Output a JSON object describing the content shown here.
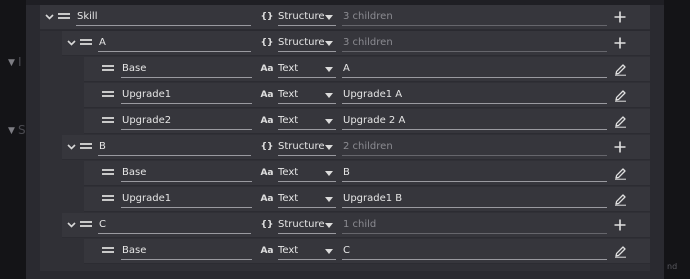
{
  "rows": [
    {
      "name": "Skill",
      "type_icon": "{}",
      "type": "Structure",
      "value": "3 children",
      "action": "plus-icon"
    },
    {
      "name": "A",
      "type_icon": "{}",
      "type": "Structure",
      "value": "3 children",
      "action": "plus-icon"
    },
    {
      "name": "Base",
      "type_icon": "Aa",
      "type": "Text",
      "value": "A",
      "action": "pencil-icon"
    },
    {
      "name": "Upgrade1",
      "type_icon": "Aa",
      "type": "Text",
      "value": "Upgrade1 A",
      "action": "pencil-icon"
    },
    {
      "name": "Upgrade2",
      "type_icon": "Aa",
      "type": "Text",
      "value": "Upgrade 2 A",
      "action": "pencil-icon"
    },
    {
      "name": "B",
      "type_icon": "{}",
      "type": "Structure",
      "value": "2 children",
      "action": "plus-icon"
    },
    {
      "name": "Base",
      "type_icon": "Aa",
      "type": "Text",
      "value": "B",
      "action": "pencil-icon"
    },
    {
      "name": "Upgrade1",
      "type_icon": "Aa",
      "type": "Text",
      "value": "Upgrade1 B",
      "action": "pencil-icon"
    },
    {
      "name": "C",
      "type_icon": "{}",
      "type": "Structure",
      "value": "1 child",
      "action": "plus-icon"
    },
    {
      "name": "Base",
      "type_icon": "Aa",
      "type": "Text",
      "value": "C",
      "action": "pencil-icon"
    }
  ],
  "background": {
    "marker_chevron": "▼",
    "marker_letter_1": "I",
    "marker_letter_2": "S",
    "right_text": "nd"
  }
}
